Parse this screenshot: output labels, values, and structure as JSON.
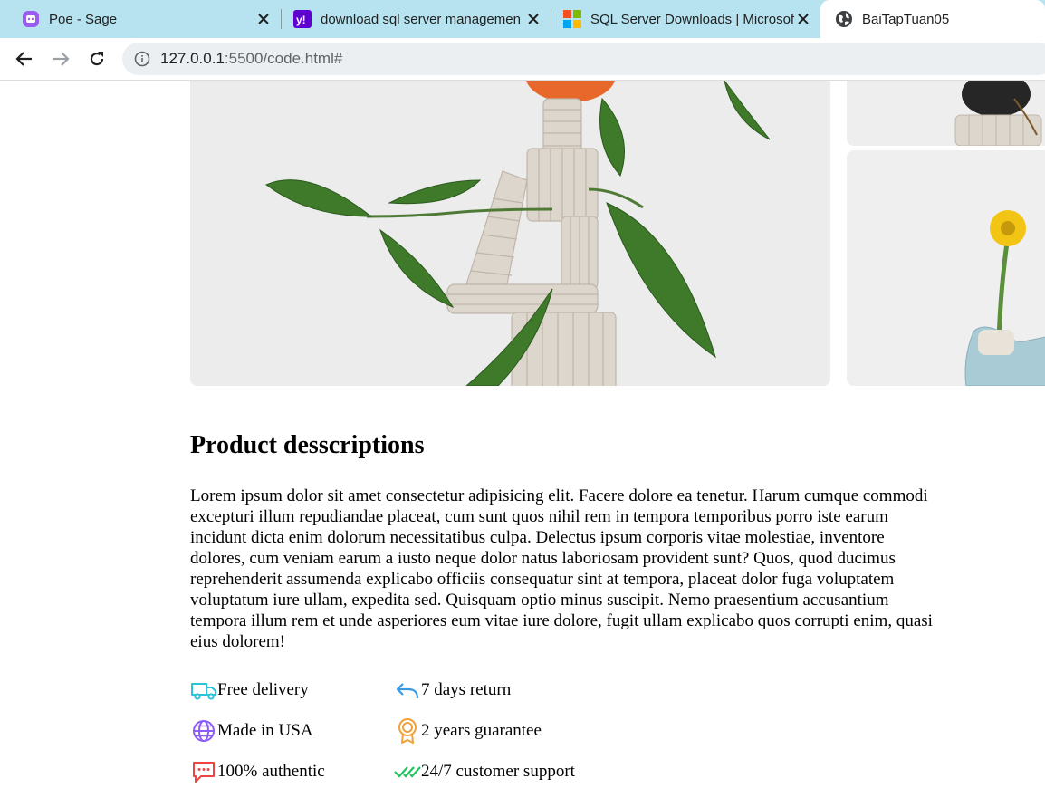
{
  "browser": {
    "tabs": [
      {
        "title": "Poe - Sage",
        "icon": "poe-icon",
        "active": false
      },
      {
        "title": "download sql server managemen",
        "icon": "yahoo-icon",
        "active": false
      },
      {
        "title": "SQL Server Downloads | Microsof",
        "icon": "microsoft-icon",
        "active": false
      },
      {
        "title": "BaiTapTuan05",
        "icon": "globe-icon",
        "active": true
      }
    ],
    "url_host": "127.0.0.1",
    "url_rest": ":5500/code.html#"
  },
  "product": {
    "heading": "Product desscriptions",
    "description": "Lorem ipsum dolor sit amet consectetur adipisicing elit. Facere dolore ea tenetur. Harum cumque commodi excepturi illum repudiandae placeat, cum sunt quos nihil rem in tempora temporibus porro iste earum incidunt dicta enim dolorum necessitatibus culpa. Delectus ipsum corporis vitae molestiae, inventore dolores, cum veniam earum a iusto neque dolor natus laboriosam provident sunt? Quos, quod ducimus reprehenderit assumenda explicabo officiis consequatur sint at tempora, placeat dolor fuga voluptatem voluptatum iure ullam, expedita sed. Quisquam optio minus suscipit. Nemo praesentium accusantium tempora illum rem et unde asperiores eum vitae iure dolore, fugit ullam explicabo quos corrupti enim, quasi eius dolorem!",
    "features": [
      {
        "label": "Free delivery",
        "icon": "truck-icon",
        "color": "#29c4d9"
      },
      {
        "label": "7 days return",
        "icon": "return-arrow-icon",
        "color": "#3b9ae1"
      },
      {
        "label": "Made in USA",
        "icon": "globe-icon",
        "color": "#8b5cf6"
      },
      {
        "label": "2 years guarantee",
        "icon": "award-icon",
        "color": "#f0a13a"
      },
      {
        "label": "100% authentic",
        "icon": "chat-bubble-icon",
        "color": "#ef4444"
      },
      {
        "label": "24/7 customer support",
        "icon": "double-check-icon",
        "color": "#22c55e"
      }
    ]
  }
}
